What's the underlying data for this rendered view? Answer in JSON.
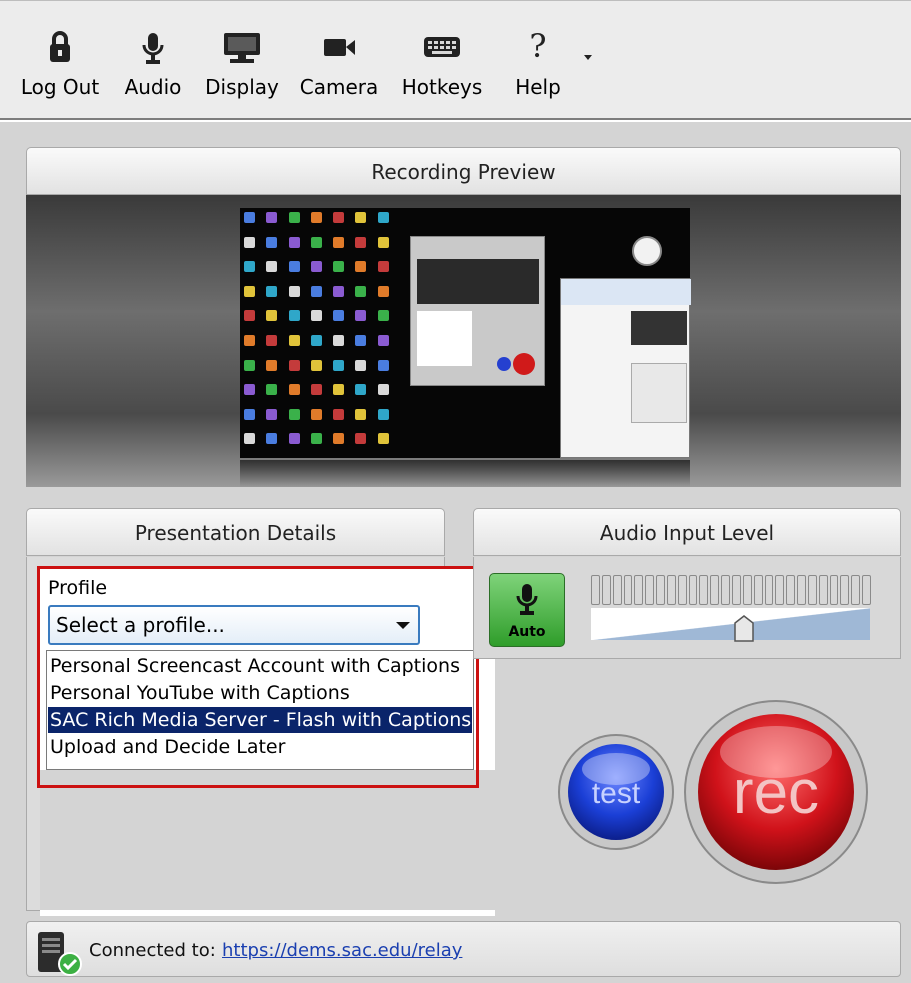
{
  "toolbar": {
    "items": [
      {
        "label": "Log Out",
        "icon": "lock-icon"
      },
      {
        "label": "Audio",
        "icon": "microphone-icon"
      },
      {
        "label": "Display",
        "icon": "monitor-icon"
      },
      {
        "label": "Camera",
        "icon": "camera-icon"
      },
      {
        "label": "Hotkeys",
        "icon": "keyboard-icon"
      },
      {
        "label": "Help",
        "icon": "help-icon"
      }
    ],
    "overflow_icon": "chevron-down-icon"
  },
  "preview": {
    "title": "Recording Preview"
  },
  "details": {
    "title": "Presentation Details",
    "profile_label": "Profile",
    "profile_select_value": "Select a profile...",
    "profile_options": [
      {
        "label": "Personal Screencast Account with Captions",
        "selected": false
      },
      {
        "label": "Personal YouTube with Captions",
        "selected": false
      },
      {
        "label": "SAC Rich Media Server - Flash with Captions",
        "selected": true
      },
      {
        "label": "Upload and Decide Later",
        "selected": false
      }
    ]
  },
  "audio": {
    "title": "Audio Input Level",
    "auto_label": "Auto",
    "meter_segments": 26,
    "meter_level": 0,
    "slider_level": 0.55
  },
  "controls": {
    "test_label": "test",
    "rec_label": "rec"
  },
  "status": {
    "connected_label": "Connected to:",
    "connected_url": "https://dems.sac.edu/relay"
  },
  "colors": {
    "highlight": "#0a246a",
    "annotation": "#cc1111",
    "auto_green": "#2f9d2a",
    "test_blue": "#1b3fd6",
    "rec_red": "#d0121a",
    "link": "#1a3fb0"
  }
}
